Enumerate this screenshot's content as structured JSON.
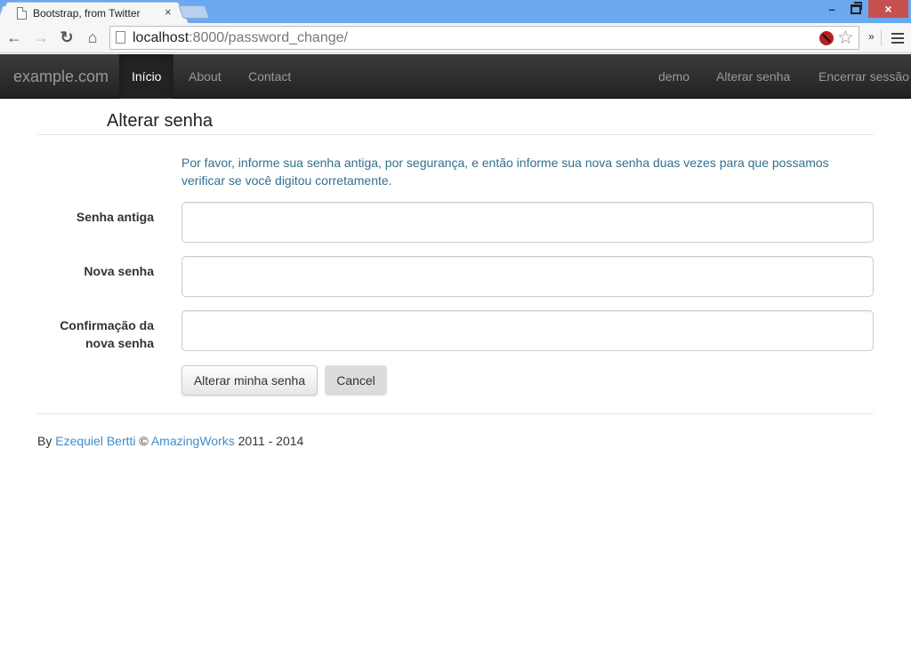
{
  "browser": {
    "tab_title": "Bootstrap, from Twitter",
    "tab_close": "×",
    "url_host": "localhost",
    "url_rest": ":8000/password_change/",
    "window_controls": {
      "minimize": "–",
      "close": "×"
    },
    "icons": {
      "back": "←",
      "forward": "→",
      "reload": "↻",
      "home": "⌂",
      "star": "☆",
      "extensions": "»"
    }
  },
  "navbar": {
    "brand": "example.com",
    "left_items": [
      {
        "label": "Início",
        "active": true
      },
      {
        "label": "About",
        "active": false
      },
      {
        "label": "Contact",
        "active": false
      }
    ],
    "right_items": [
      {
        "label": "demo"
      },
      {
        "label": "Alterar senha"
      },
      {
        "label": "Encerrar sessão"
      }
    ]
  },
  "page": {
    "title": "Alterar senha",
    "help_text": "Por favor, informe sua senha antiga, por segurança, e então informe sua nova senha duas vezes para que possamos verificar se você digitou corretamente.",
    "fields": [
      {
        "label": "Senha antiga",
        "value": ""
      },
      {
        "label": "Nova senha",
        "value": ""
      },
      {
        "label": "Confirmação da nova senha",
        "value": ""
      }
    ],
    "submit_label": "Alterar minha senha",
    "cancel_label": "Cancel"
  },
  "footer": {
    "prefix": "By ",
    "author": "Ezequiel Bertti",
    "copyright": " © ",
    "company": "AmazingWorks",
    "years": " 2011 - 2014"
  },
  "colors": {
    "link": "#428bca",
    "help_text": "#31708f",
    "navbar_bg": "#222222",
    "titlebar": "#6aa9f0",
    "close_button": "#c75050"
  }
}
